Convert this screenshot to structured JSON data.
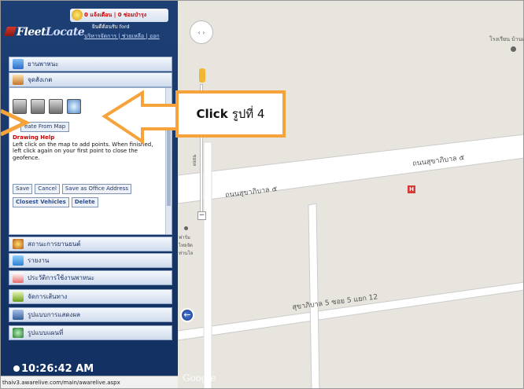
{
  "header": {
    "alert_text": "0 แจ้งเตือน | 0 ซ่อมบำรุง",
    "logo_part1": "Fleet",
    "logo_part2": "Locate",
    "welcome": "ยินดีต้อนรับ ford",
    "links": "บริหารจัดการ | ช่วยเหลือ | ออก"
  },
  "nav_top": [
    {
      "label": "ยานพาหนะ",
      "icon": "truck-icon"
    },
    {
      "label": "จุดสังเกต",
      "icon": "house-icon"
    }
  ],
  "panel": {
    "tools": [
      "house-tool-icon",
      "circle-tool-icon",
      "polygon-tool-icon",
      "map-tool-icon"
    ],
    "create_button": "eate From Map",
    "help_title": "Drawing Help",
    "help_text": "Left click on the map to add points. When finished, left click again on your first point to close the geofence.",
    "buttons_row1": [
      "Save",
      "Cancel",
      "Save as Office Address"
    ],
    "buttons_row2": [
      "Closest Vehicles",
      "Delete"
    ]
  },
  "nav_bottom": [
    {
      "label": "สถานะการยานยนต์",
      "icon": "gauge-icon"
    },
    {
      "label": "รายงาน",
      "icon": "report-icon"
    },
    {
      "label": "ประวัติการใช้งานพาหนะ",
      "icon": "history-icon"
    },
    {
      "label": "จัดการเส้นทาง",
      "icon": "route-icon"
    },
    {
      "label": "รูปแบบการแสดงผล",
      "icon": "monitor-icon"
    },
    {
      "label": "รูปแบบแผนที่",
      "icon": "globe-icon"
    }
  ],
  "clock": "10:26:42 AM",
  "status_url": "thaiv3.awarelive.com/main/awarelive.aspx",
  "map": {
    "school_label": "โรงเรียน บ้านคลองบัว",
    "road1_a": "ถนนสุขาภิบาล ๕",
    "road1_b": "ถนนสุขาภิบาล ๕",
    "road2": "สุขาภิบาล 5 ซอย 5 แยก 12",
    "side_label_1": "ฟาร์มไทยจัด ท่านโล",
    "vertical_label": "ซอยล",
    "google": "Google",
    "hospital_icon_text": "H",
    "compass_symbols": "‹ ›",
    "zoom_minus": "−"
  },
  "callout": {
    "bold": "Click",
    "rest": "รูปที่ 4",
    "accent": "#f5a33a"
  },
  "collapse_symbol": "←"
}
